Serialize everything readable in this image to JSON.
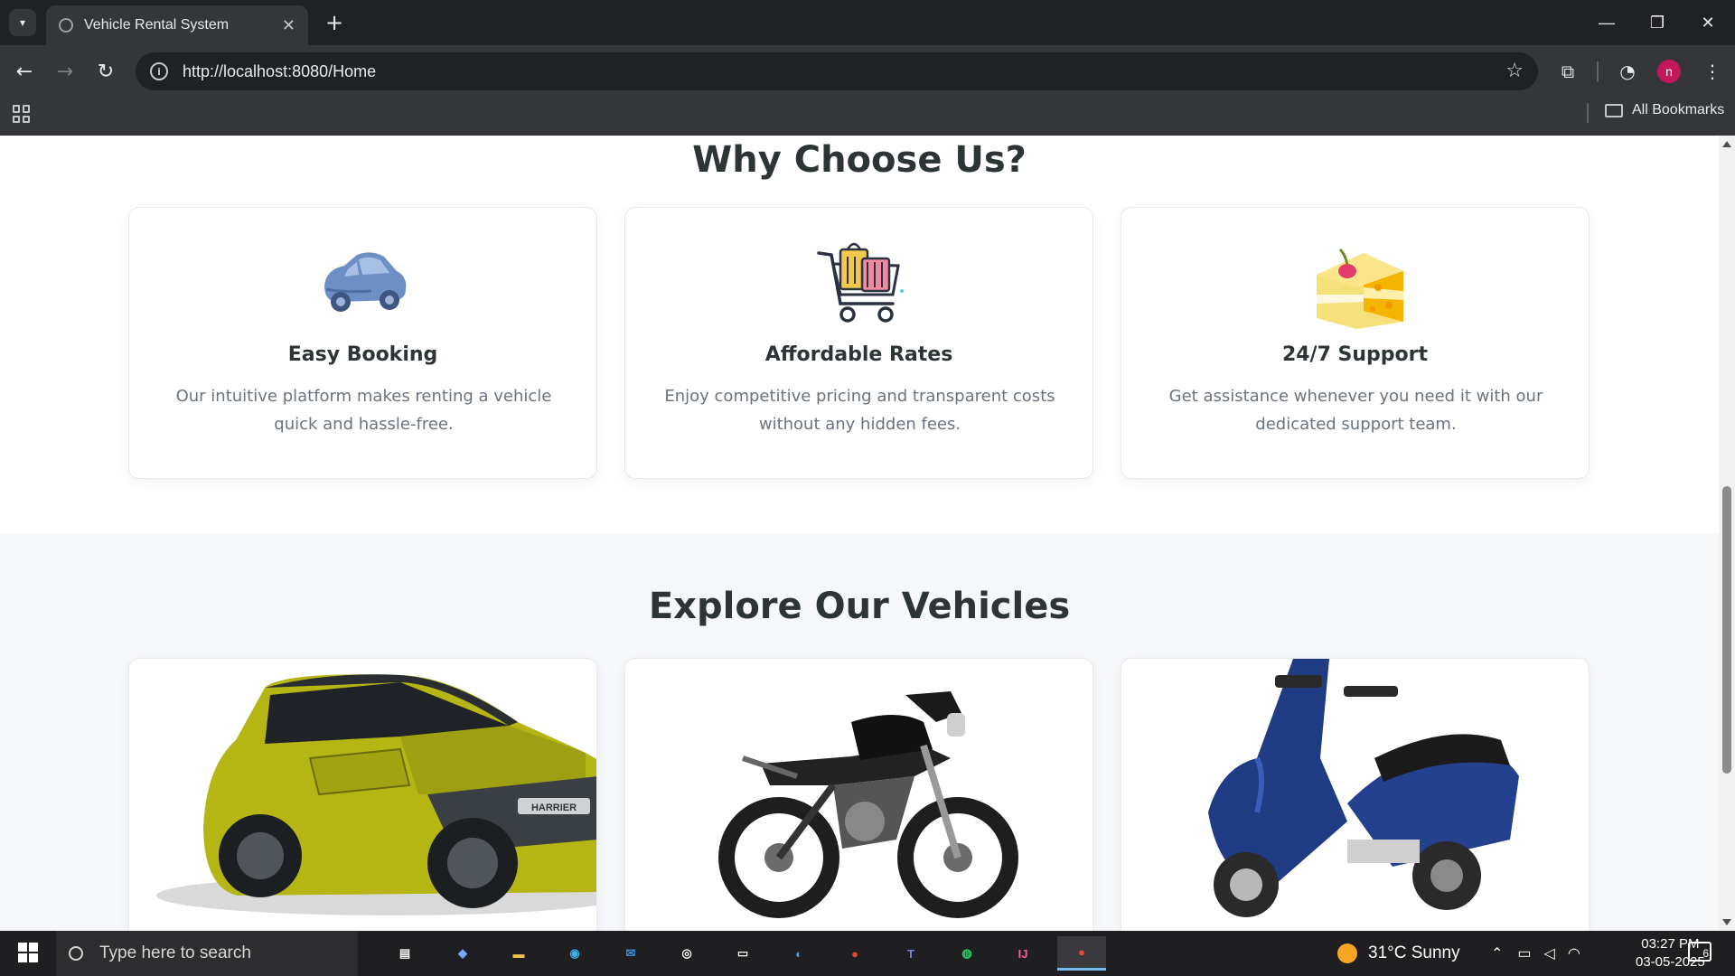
{
  "browser": {
    "tab_title": "Vehicle Rental System",
    "url": "http://localhost:8080/Home",
    "profile_initial": "n",
    "bookmarks_label": "All Bookmarks"
  },
  "page": {
    "why_title": "Why Choose Us?",
    "features": [
      {
        "title": "Easy Booking",
        "text": "Our intuitive platform makes renting a vehicle quick and hassle-free.",
        "icon": "car-icon"
      },
      {
        "title": "Affordable Rates",
        "text": "Enjoy competitive pricing and transparent costs without any hidden fees.",
        "icon": "shopping-cart-icon"
      },
      {
        "title": "24/7 Support",
        "text": "Get assistance whenever you need it with our dedicated support team.",
        "icon": "cake-icon"
      }
    ],
    "explore_title": "Explore Our Vehicles",
    "vehicles": [
      {
        "image": "yellow-suv-image",
        "badge": "HARRIER"
      },
      {
        "image": "black-motorcycle-image"
      },
      {
        "image": "blue-scooter-image"
      }
    ]
  },
  "taskbar": {
    "search_placeholder": "Type here to search",
    "weather": "31°C  Sunny",
    "time": "03:27 PM",
    "date": "03-05-2025",
    "notification_count": "6"
  },
  "colors": {
    "heading": "#2d3436",
    "body_text": "#6b7280",
    "section_bg": "#f6f7f9",
    "profile_bg": "#c2185b"
  }
}
